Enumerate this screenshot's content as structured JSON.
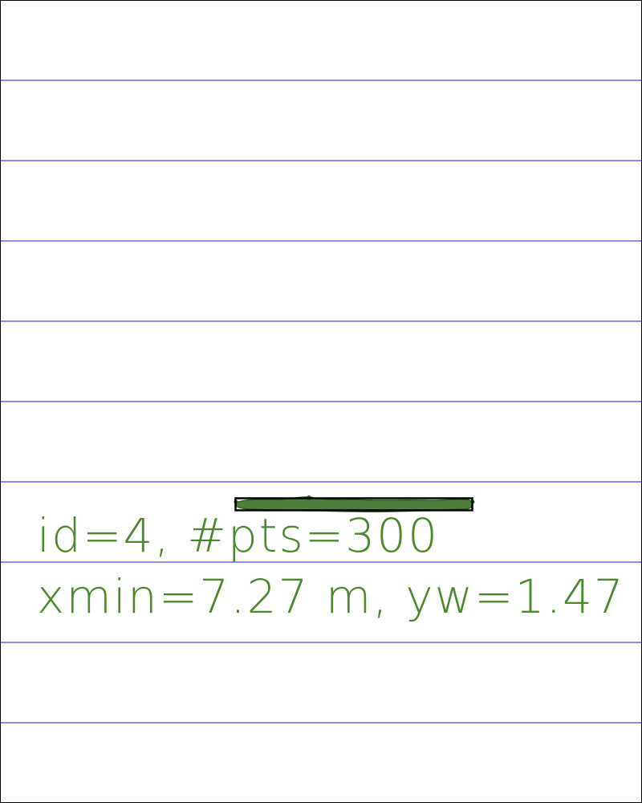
{
  "colors": {
    "background": "#ffffff",
    "frame": "#000000",
    "grid_lines": "#1a1ae6",
    "object_fill": "#4f7f3a",
    "object_outline": "#2f5f22",
    "bbox": "#000000",
    "text": "#4b8a2a"
  },
  "annotation": {
    "id_line": "id=4, #pts=300",
    "position_line": "xmin=7.27 m, yw=1.47"
  }
}
